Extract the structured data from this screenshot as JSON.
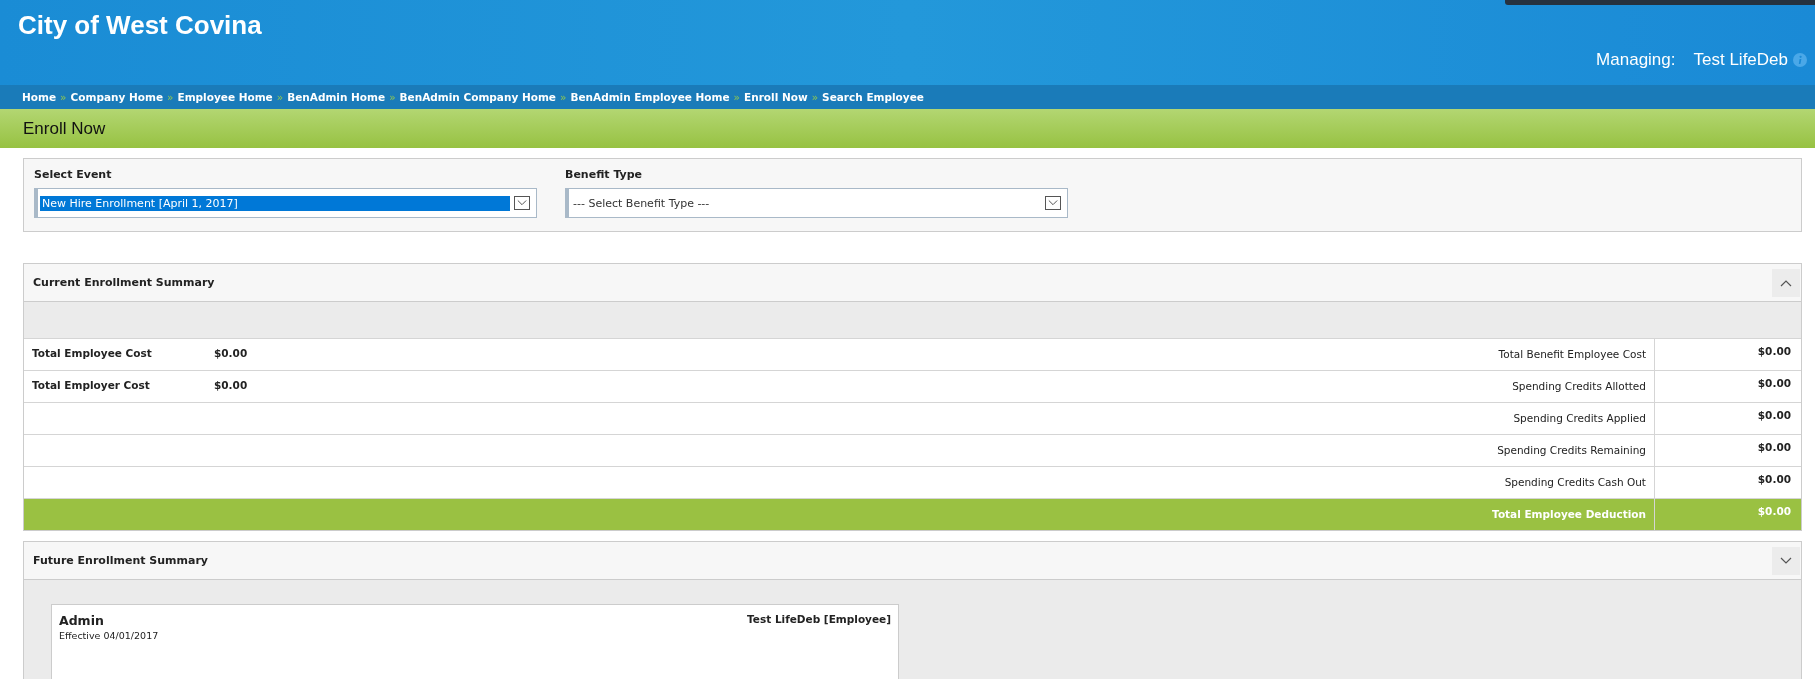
{
  "header": {
    "title": "City of West Covina",
    "managing_label": "Managing:",
    "managing_name": "Test LifeDeb"
  },
  "breadcrumbs": {
    "separator": "»",
    "items": [
      "Home",
      "Company Home",
      "Employee Home",
      "BenAdmin Home",
      "BenAdmin Company Home",
      "BenAdmin Employee Home",
      "Enroll Now",
      "Search Employee"
    ]
  },
  "page_title": "Enroll Now",
  "filters": [
    {
      "label": "Select Event",
      "value": "New Hire Enrollment [April 1, 2017]",
      "focused": true
    },
    {
      "label": "Benefit Type",
      "value": "--- Select Benefit Type ---",
      "focused": false
    }
  ],
  "current_summary": {
    "title": "Current Enrollment Summary",
    "expanded": true,
    "rows": [
      {
        "left_label": "Total Employee Cost",
        "left_value": "$0.00",
        "label": "Total Benefit Employee Cost",
        "value": "$0.00"
      },
      {
        "left_label": "Total Employer Cost",
        "left_value": "$0.00",
        "label": "Spending Credits Allotted",
        "value": "$0.00"
      },
      {
        "label": "Spending Credits Applied",
        "value": "$0.00"
      },
      {
        "label": "Spending Credits Remaining",
        "value": "$0.00"
      },
      {
        "label": "Spending Credits Cash Out",
        "value": "$0.00"
      }
    ],
    "total": {
      "label": "Total Employee Deduction",
      "value": "$0.00"
    }
  },
  "future_summary": {
    "title": "Future Enrollment Summary",
    "expanded": false,
    "cards": [
      {
        "title": "Admin",
        "subtitle": "Effective 04/01/2017",
        "person": "Test LifeDeb [Employee]"
      }
    ]
  }
}
